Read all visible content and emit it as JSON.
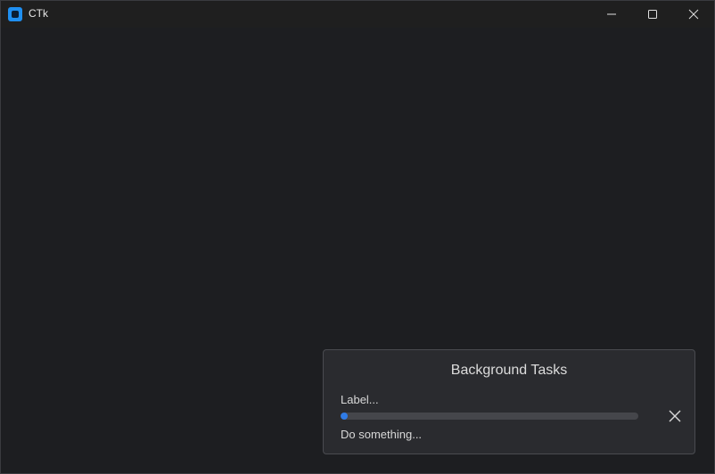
{
  "window": {
    "title": "CTk",
    "icon": "app-icon",
    "controls": [
      "minimize-icon",
      "maximize-icon",
      "close-icon"
    ]
  },
  "background_tasks": {
    "title": "Background Tasks",
    "task": {
      "label": "Label...",
      "progress": 0.025,
      "status": "Do something...",
      "close_icon": "close-icon"
    }
  },
  "colors": {
    "background": "#1d1e21",
    "panel": "#2a2b2f",
    "accent": "#2f7be6",
    "track": "#45464b"
  }
}
